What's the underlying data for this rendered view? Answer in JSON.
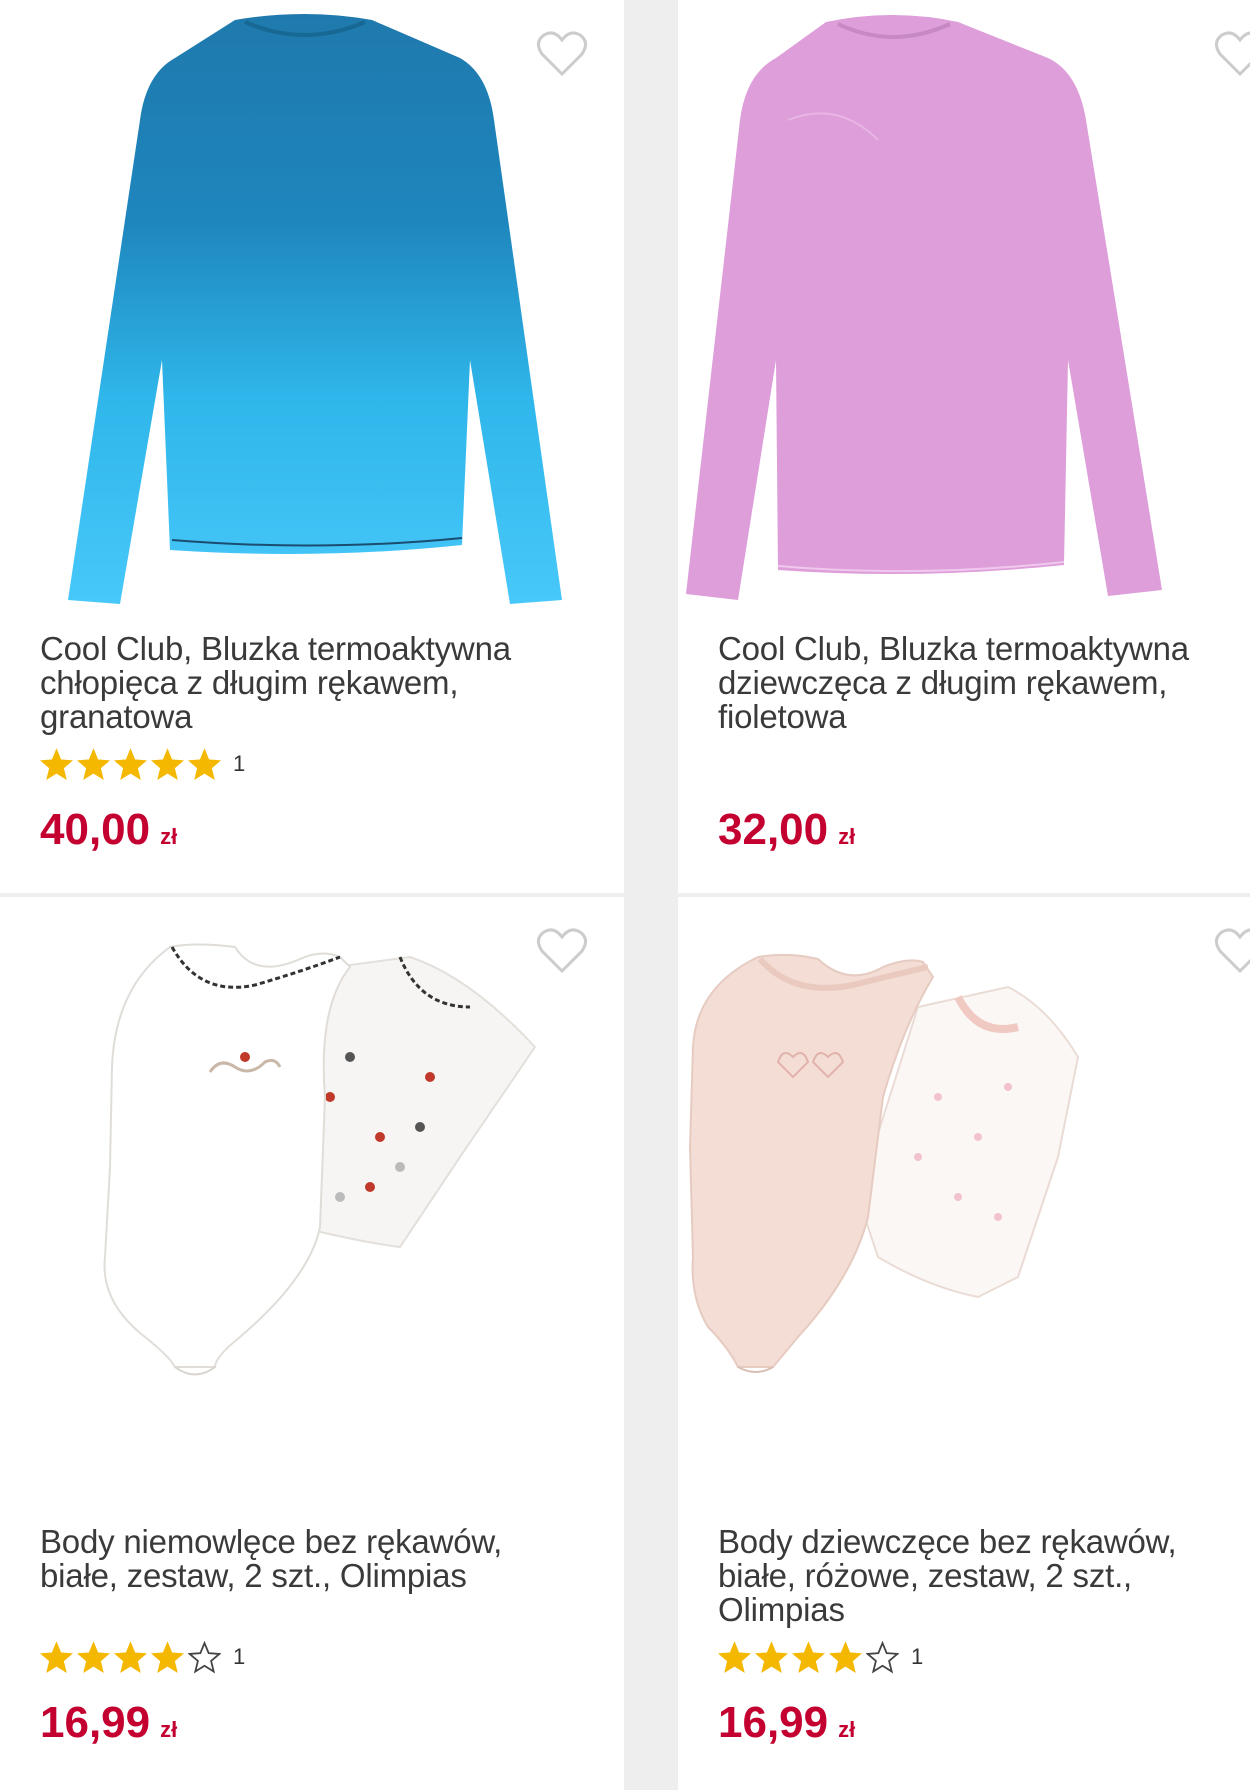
{
  "products": [
    {
      "title_lines": [
        "Cool Club, Bluzka termoaktywna",
        "chłopięca z długim rękawem,",
        "granatowa"
      ],
      "rating_stars": 5,
      "rating_count": "1",
      "price": "40,00",
      "currency": "zł",
      "image": "blue-ombre-long-sleeve-shirt"
    },
    {
      "title_lines": [
        "Cool Club, Bluzka termoaktywna",
        "dziewczęca z długim rękawem,",
        "fioletowa"
      ],
      "rating_stars": 0,
      "rating_count": "",
      "price": "32,00",
      "currency": "zł",
      "image": "pink-long-sleeve-shirt"
    },
    {
      "title_lines": [
        "Body niemowlęce bez rękawów,",
        "białe, zestaw, 2 szt., Olimpias"
      ],
      "rating_stars": 4,
      "rating_count": "1",
      "price": "16,99",
      "currency": "zł",
      "image": "white-sleeveless-bodysuit-set"
    },
    {
      "title_lines": [
        "Body dziewczęce bez rękawów,",
        "białe, różowe, zestaw, 2 szt.,",
        "Olimpias"
      ],
      "rating_stars": 4,
      "rating_count": "1",
      "price": "16,99",
      "currency": "zł",
      "image": "pink-white-sleeveless-bodysuit-set"
    }
  ],
  "colors": {
    "price": "#c3002f",
    "star": "#f5b800",
    "heart": "#cccccc"
  }
}
